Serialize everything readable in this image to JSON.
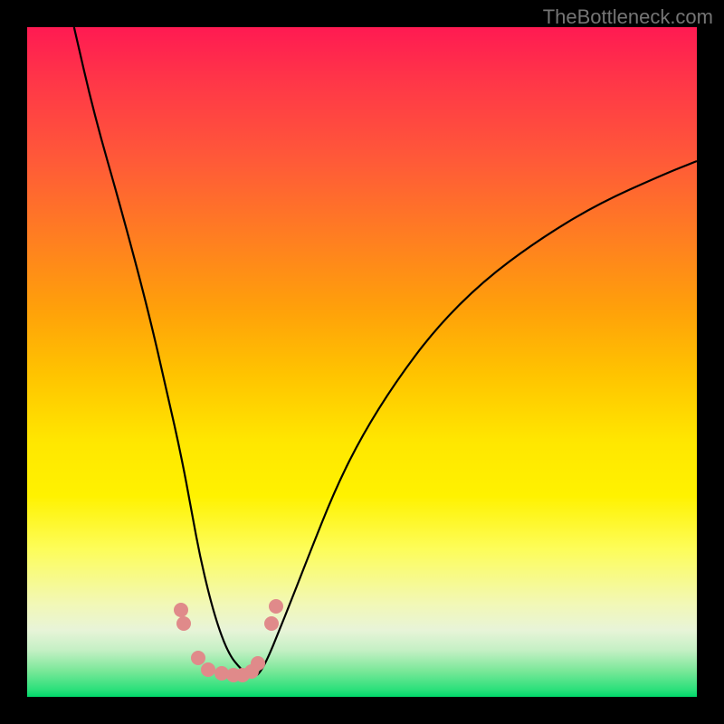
{
  "watermark": "TheBottleneck.com",
  "chart_data": {
    "type": "line",
    "title": "",
    "xlabel": "",
    "ylabel": "",
    "xlim": [
      0,
      100
    ],
    "ylim": [
      0,
      100
    ],
    "series": [
      {
        "name": "curve",
        "x": [
          7,
          10,
          14,
          18,
          21,
          23,
          24.5,
          26,
          28,
          30,
          32,
          33.5,
          35,
          38.5,
          42,
          46,
          50,
          55,
          61,
          68,
          76,
          85,
          95,
          100
        ],
        "y": [
          100,
          87,
          73,
          58,
          45,
          36,
          28,
          20,
          12,
          6.5,
          4,
          3,
          3.5,
          12,
          21,
          31,
          39,
          47,
          55,
          62,
          68,
          73.5,
          78,
          80
        ]
      }
    ],
    "markers": [
      {
        "x": 23.0,
        "y": 13.0
      },
      {
        "x": 23.4,
        "y": 11.0
      },
      {
        "x": 25.5,
        "y": 5.8
      },
      {
        "x": 27.0,
        "y": 4.0
      },
      {
        "x": 29.0,
        "y": 3.5
      },
      {
        "x": 30.8,
        "y": 3.3
      },
      {
        "x": 32.2,
        "y": 3.3
      },
      {
        "x": 33.5,
        "y": 3.8
      },
      {
        "x": 34.5,
        "y": 5.0
      },
      {
        "x": 36.5,
        "y": 11.0
      },
      {
        "x": 37.2,
        "y": 13.5
      }
    ]
  }
}
